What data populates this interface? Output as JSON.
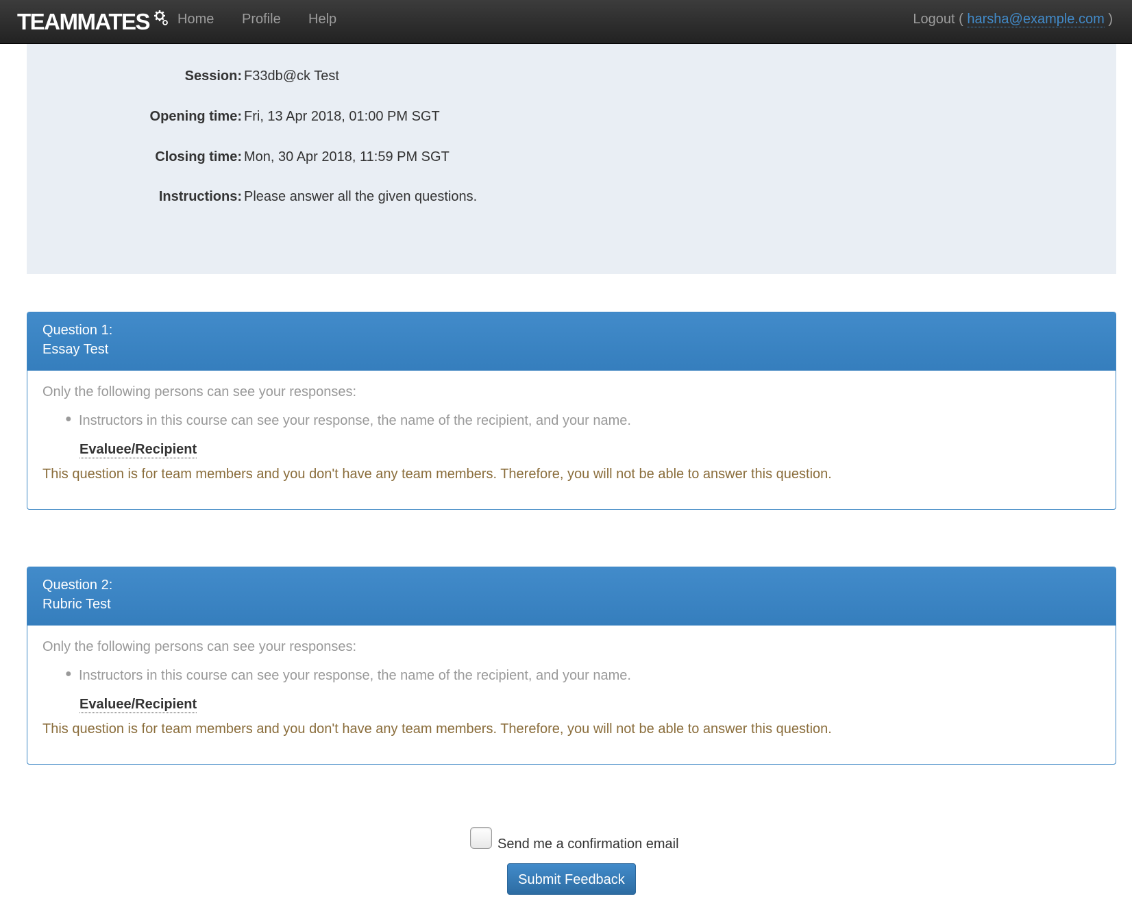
{
  "navbar": {
    "brand": "TEAMMATES",
    "links": [
      "Home",
      "Profile",
      "Help"
    ],
    "logout_label": "Logout (",
    "logout_email": "harsha@example.com",
    "logout_close": ")"
  },
  "session_info": {
    "session_label": "Session:",
    "session_value": "F33db@ck Test",
    "opening_label": "Opening time:",
    "opening_value": "Fri, 13 Apr 2018, 01:00 PM SGT",
    "closing_label": "Closing time:",
    "closing_value": "Mon, 30 Apr 2018, 11:59 PM SGT",
    "instructions_label": "Instructions:",
    "instructions_value": "Please answer all the given questions."
  },
  "questions": [
    {
      "number_label": "Question 1:",
      "title": "Essay Test",
      "visibility_intro": "Only the following persons can see your responses:",
      "visibility_item": "Instructors in this course can see your response, the name of the recipient, and your name.",
      "recipient_label": "Evaluee/Recipient",
      "warning": "This question is for team members and you don't have any team members. Therefore, you will not be able to answer this question."
    },
    {
      "number_label": "Question 2:",
      "title": "Rubric Test",
      "visibility_intro": "Only the following persons can see your responses:",
      "visibility_item": "Instructors in this course can see your response, the name of the recipient, and your name.",
      "recipient_label": "Evaluee/Recipient",
      "warning": "This question is for team members and you don't have any team members. Therefore, you will not be able to answer this question."
    }
  ],
  "footer": {
    "confirmation_label": "Send me a confirmation email",
    "submit_label": "Submit Feedback"
  },
  "colors": {
    "navbar_bg": "#222222",
    "panel_heading": "#428bca",
    "well_bg": "#e9eef4",
    "warning_text": "#8a6d3b",
    "link": "#428bca"
  }
}
